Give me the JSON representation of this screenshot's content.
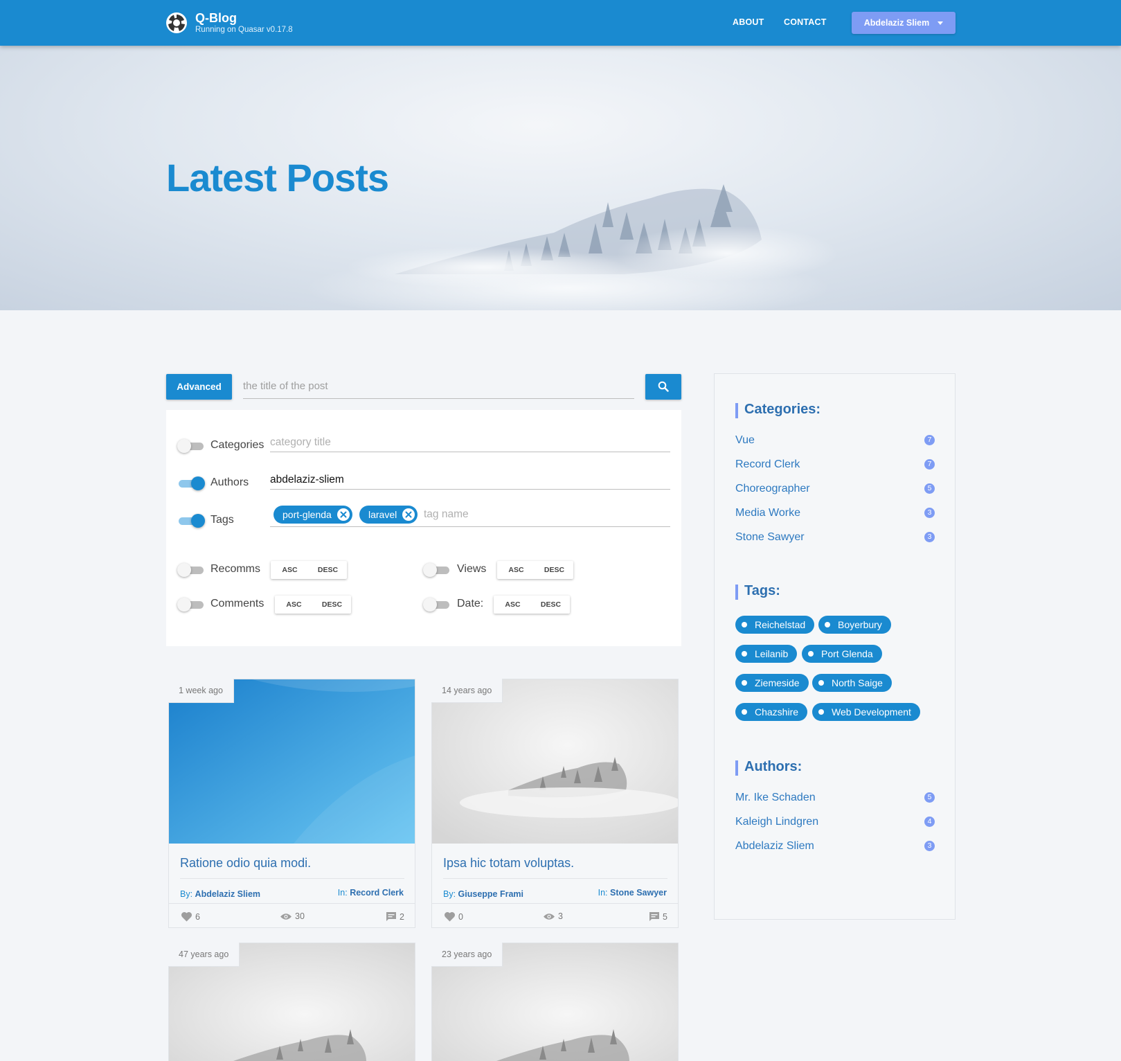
{
  "header": {
    "title": "Q-Blog",
    "subtitle": "Running on Quasar v0.17.8",
    "nav": {
      "about": "ABOUT",
      "contact": "CONTACT"
    },
    "user": "Abdelaziz Sliem"
  },
  "hero": {
    "title": "Latest Posts"
  },
  "search": {
    "advanced_label": "Advanced",
    "placeholder": "the title of the post"
  },
  "filters": {
    "categories": {
      "label": "Categories",
      "enabled": false,
      "placeholder": "category title",
      "value": ""
    },
    "authors": {
      "label": "Authors",
      "enabled": true,
      "value": "abdelaziz-sliem"
    },
    "tags": {
      "label": "Tags",
      "enabled": true,
      "chips": [
        "port-glenda",
        "laravel"
      ],
      "placeholder": "tag name"
    },
    "sort": {
      "asc": "ASC",
      "desc": "DESC",
      "recomms": {
        "label": "Recomms",
        "enabled": false
      },
      "views": {
        "label": "Views",
        "enabled": false
      },
      "comments": {
        "label": "Comments",
        "enabled": false
      },
      "date": {
        "label": "Date:",
        "enabled": false
      }
    }
  },
  "posts": [
    {
      "age": "1 week ago",
      "title": "Ratione odio quia modi.",
      "by_label": "By:",
      "author": "Abdelaziz Sliem",
      "in_label": "In:",
      "category": "Record Clerk",
      "likes": "6",
      "views": "30",
      "comments": "2"
    },
    {
      "age": "14 years ago",
      "title": "Ipsa hic totam voluptas.",
      "by_label": "By:",
      "author": "Giuseppe Frami",
      "in_label": "In:",
      "category": "Stone Sawyer",
      "likes": "0",
      "views": "3",
      "comments": "5"
    },
    {
      "age": "47 years ago"
    },
    {
      "age": "23 years ago"
    }
  ],
  "sidebar": {
    "categories_heading": "Categories:",
    "categories": [
      {
        "name": "Vue",
        "count": "7"
      },
      {
        "name": "Record Clerk",
        "count": "7"
      },
      {
        "name": "Choreographer",
        "count": "5"
      },
      {
        "name": "Media Worke",
        "count": "3"
      },
      {
        "name": "Stone Sawyer",
        "count": "3"
      }
    ],
    "tags_heading": "Tags:",
    "tags": [
      "Reichelstad",
      "Boyerbury",
      "Leilanib",
      "Port Glenda",
      "Ziemeside",
      "North Saige",
      "Chazshire",
      "Web Development"
    ],
    "authors_heading": "Authors:",
    "authors": [
      {
        "name": "Mr. Ike Schaden",
        "count": "5"
      },
      {
        "name": "Kaleigh Lindgren",
        "count": "4"
      },
      {
        "name": "Abdelaziz Sliem",
        "count": "3"
      }
    ]
  },
  "colors": {
    "primary": "#1a8ad0",
    "accent": "#7e9cf4",
    "link": "#2d6fb0",
    "background": "#f3f5f8"
  }
}
